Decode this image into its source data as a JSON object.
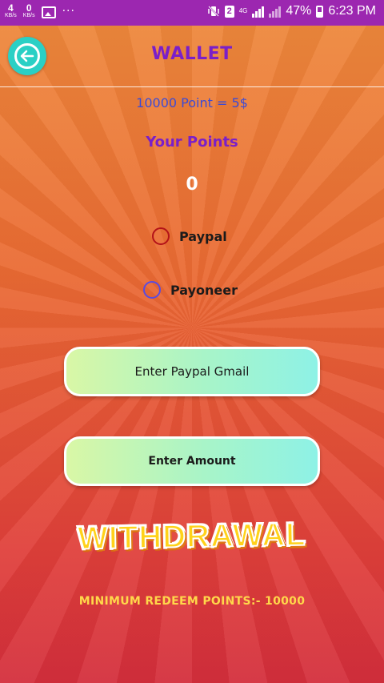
{
  "status_bar": {
    "net_up": "4",
    "net_up_unit": "KB/s",
    "net_down": "0",
    "net_down_unit": "KB/s",
    "more": "···",
    "sim": "2",
    "network_type": "4G",
    "battery": "47%",
    "time": "6:23 PM",
    "background_color": "#9c27b0"
  },
  "header": {
    "title": "WALLET",
    "back_icon": "arrow-left-icon"
  },
  "rate_text": "10000 Point = 5$",
  "points_label": "Your Points",
  "points_value": "0",
  "payment_methods": [
    {
      "label": "Paypal",
      "selected": false,
      "color": "#b31218"
    },
    {
      "label": "Payoneer",
      "selected": false,
      "color": "#5a4be0"
    }
  ],
  "inputs": {
    "email_placeholder": "Enter Paypal Gmail",
    "amount_placeholder": "Enter Amount"
  },
  "withdraw_label": "WITHDRAWAL",
  "min_redeem": "MINIMUM REDEEM POINTS:- 10000",
  "colors": {
    "title": "#7a1fc9",
    "rate": "#3c4bd6",
    "back_button": "#2ad0c5",
    "accent_yellow": "#ffd21a"
  }
}
